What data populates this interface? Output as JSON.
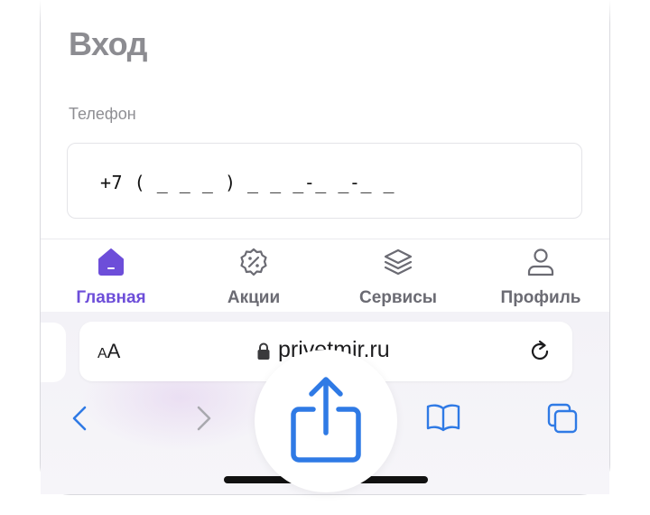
{
  "login": {
    "title": "Вход",
    "phone_label": "Телефон",
    "phone_mask": "+7 ( _ _ _ ) _ _ _-_ _-_ _"
  },
  "tabbar": {
    "items": [
      {
        "label": "Главная",
        "icon": "home-icon",
        "active": true
      },
      {
        "label": "Акции",
        "icon": "discount-badge-icon",
        "active": false
      },
      {
        "label": "Сервисы",
        "icon": "layers-icon",
        "active": false
      },
      {
        "label": "Профиль",
        "icon": "person-icon",
        "active": false
      }
    ],
    "active_color": "#6d4ed9",
    "inactive_color": "#6b6b73"
  },
  "browser": {
    "aa_small": "A",
    "aa_large": "A",
    "url": "privetmir.ru",
    "accent_color": "#2f7ae5"
  }
}
